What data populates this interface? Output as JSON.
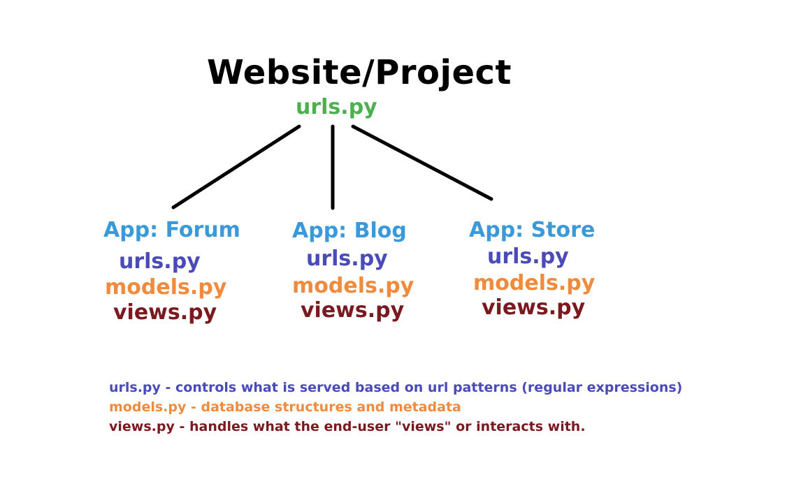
{
  "title": "Website/Project",
  "root_file": "urls.py",
  "colors": {
    "title": "#000000",
    "root_file": "#4caf50",
    "app_name": "#3a9ad9",
    "urls": "#4a4ab8",
    "models": "#f08a3c",
    "views": "#7a1a20",
    "edge": "#000000"
  },
  "apps": [
    {
      "name": "App: Forum",
      "files": [
        "urls.py",
        "models.py",
        "views.py"
      ]
    },
    {
      "name": "App: Blog",
      "files": [
        "urls.py",
        "models.py",
        "views.py"
      ]
    },
    {
      "name": "App: Store",
      "files": [
        "urls.py",
        "models.py",
        "views.py"
      ]
    }
  ],
  "legend": [
    "urls.py - controls what is served based on url patterns (regular expressions)",
    "models.py - database structures and metadata",
    "views.py - handles what the end-user \"views\" or interacts with."
  ]
}
